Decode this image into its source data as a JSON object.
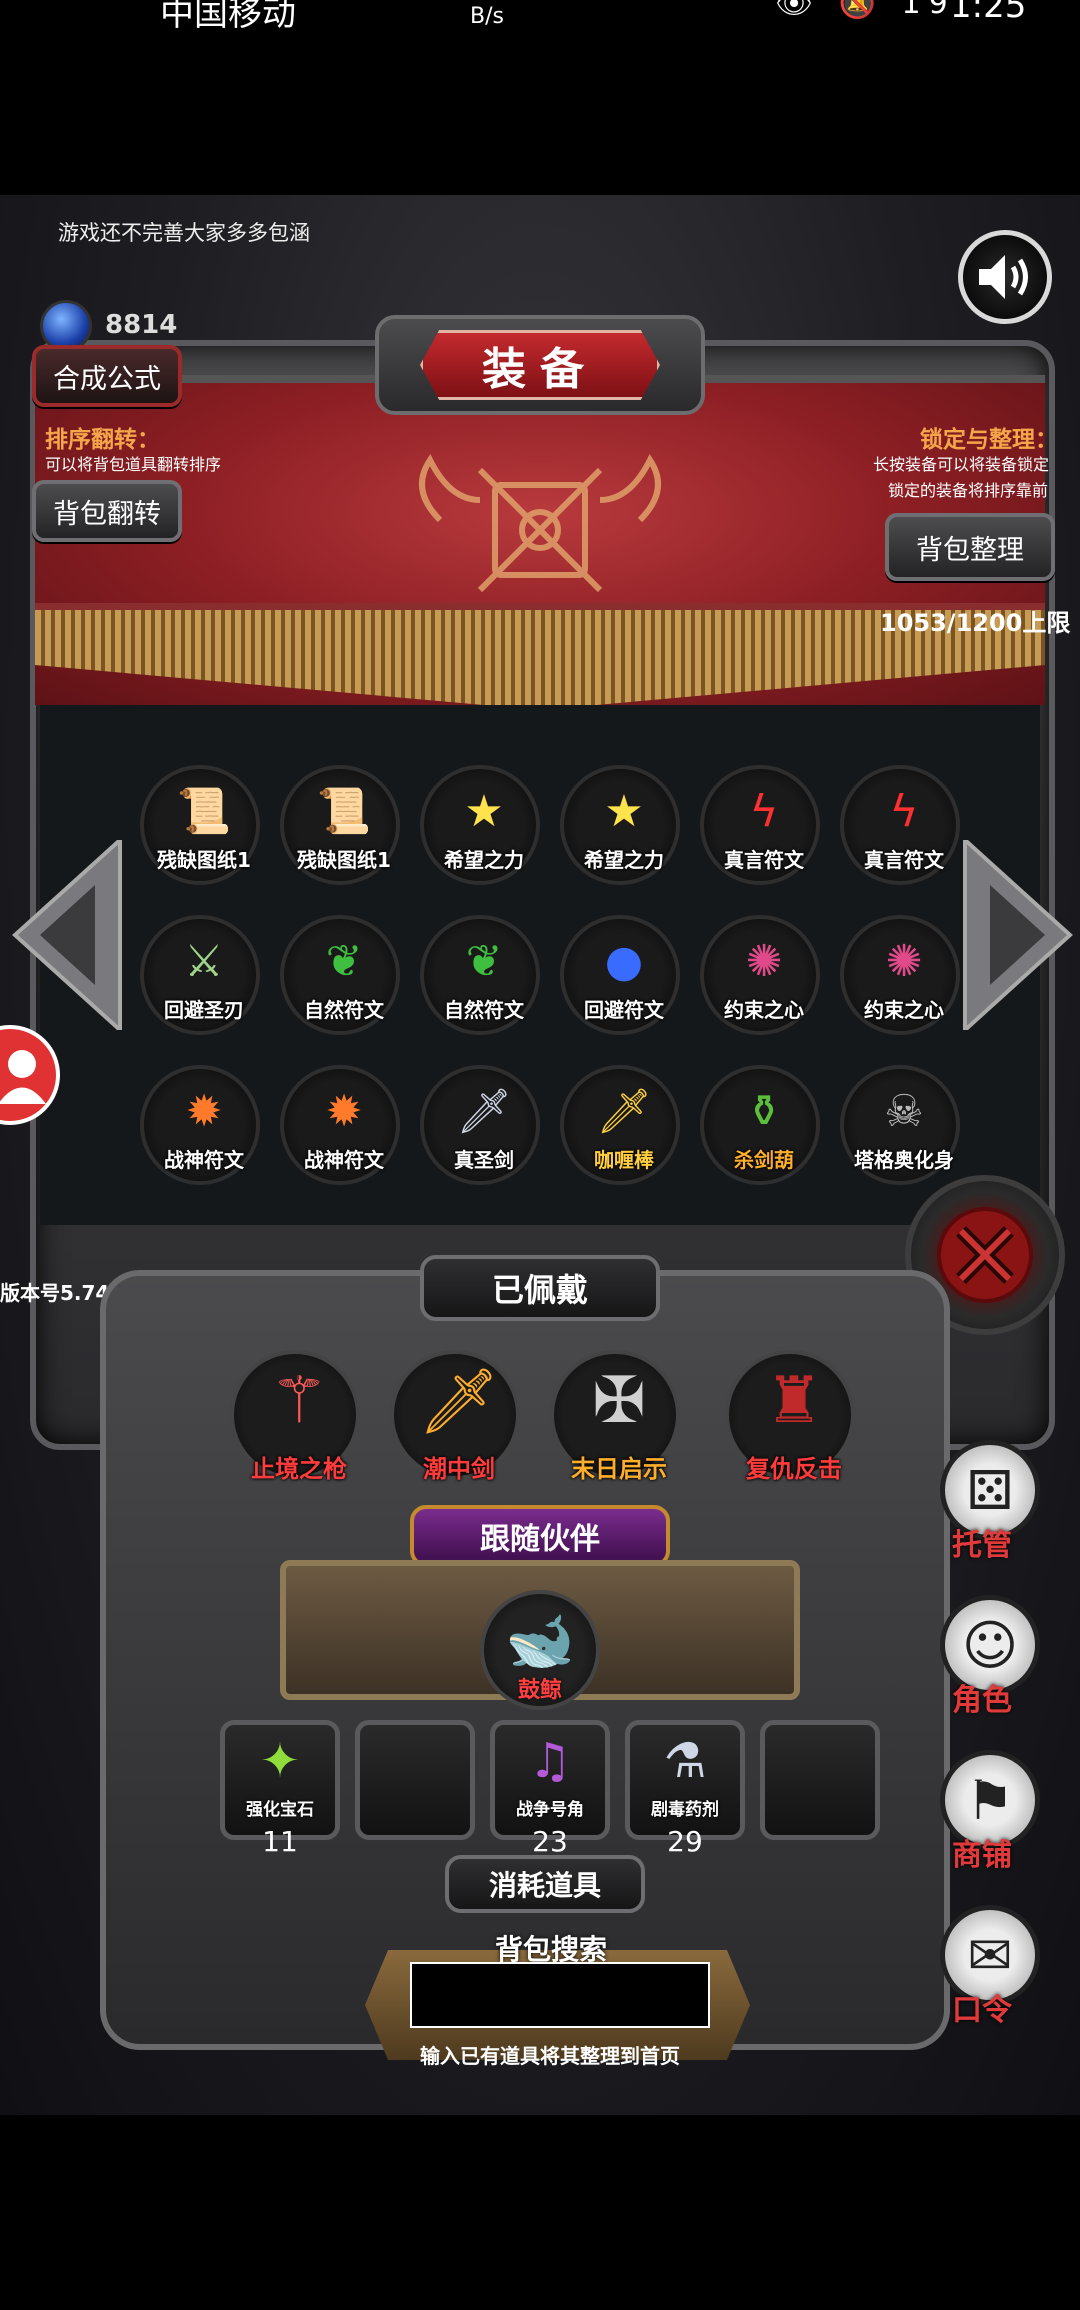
{
  "status": {
    "carrier": "中国移动",
    "hd": "HD",
    "net_speed": "B/s",
    "battery": "19",
    "time": "1:25"
  },
  "notice": "游戏还不完善大家多多包涵",
  "gems": "8814",
  "title": "装备",
  "buttons": {
    "synthesis": "合成公式",
    "bag_flip": "背包翻转",
    "bag_sort": "背包整理"
  },
  "sort_flip": {
    "label": "排序翻转：",
    "desc": "可以将背包道具翻转排序"
  },
  "lock_sort": {
    "label": "锁定与整理：",
    "desc1": "长按装备可以将装备锁定",
    "desc2": "锁定的装备将排序靠前"
  },
  "capacity": "1053/1200上限",
  "inventory": [
    {
      "name": "残缺图纸1",
      "icon": "scroll-icon",
      "glyph": "📜"
    },
    {
      "name": "残缺图纸1",
      "icon": "scroll-icon",
      "glyph": "📜"
    },
    {
      "name": "希望之力",
      "icon": "star-icon",
      "glyph": "★"
    },
    {
      "name": "希望之力",
      "icon": "star-icon",
      "glyph": "★"
    },
    {
      "name": "真言符文",
      "icon": "rune-icon",
      "glyph": "ϟ"
    },
    {
      "name": "真言符文",
      "icon": "rune-icon",
      "glyph": "ϟ"
    },
    {
      "name": "回避圣刃",
      "icon": "blade-icon",
      "glyph": "⚔"
    },
    {
      "name": "自然符文",
      "icon": "leaf-icon",
      "glyph": "❦"
    },
    {
      "name": "自然符文",
      "icon": "leaf-icon",
      "glyph": "❦"
    },
    {
      "name": "回避符文",
      "icon": "orb-icon",
      "glyph": "●"
    },
    {
      "name": "约束之心",
      "icon": "heart-icon",
      "glyph": "✺"
    },
    {
      "name": "约束之心",
      "icon": "heart-icon",
      "glyph": "✺"
    },
    {
      "name": "战神符文",
      "icon": "fire-rune-icon",
      "glyph": "✹"
    },
    {
      "name": "战神符文",
      "icon": "fire-rune-icon",
      "glyph": "✹"
    },
    {
      "name": "真圣剑",
      "icon": "sword-icon",
      "glyph": "🗡"
    },
    {
      "name": "咖喱棒",
      "icon": "gold-sword-icon",
      "glyph": "🗡"
    },
    {
      "name": "杀剑葫",
      "icon": "gourd-icon",
      "glyph": "⚱"
    },
    {
      "name": "塔格奥化身",
      "icon": "monster-icon",
      "glyph": "☠"
    }
  ],
  "version": "版本号5.74",
  "equipped_title": "已佩戴",
  "equipped": [
    {
      "name": "止境之枪",
      "color": "#ff3b3b",
      "icon": "spear-icon",
      "glyph": "⚚"
    },
    {
      "name": "潮中剑",
      "color": "#ff3b3b",
      "icon": "great-sword-icon",
      "glyph": "🗡"
    },
    {
      "name": "末日启示",
      "color": "#ffae2b",
      "icon": "cross-icon",
      "glyph": "✠"
    },
    {
      "name": "复仇反击",
      "color": "#ff3b3b",
      "icon": "armor-icon",
      "glyph": "♜"
    }
  ],
  "companion_title": "跟随伙伴",
  "companion": {
    "name": "鼓鲸",
    "icon": "whale-icon",
    "glyph": "🐋"
  },
  "consumables_title": "消耗道具",
  "consumables": [
    {
      "name": "强化宝石",
      "count": "11",
      "icon": "gem-icon",
      "glyph": "✦"
    },
    {
      "name": "",
      "count": "",
      "icon": "",
      "glyph": ""
    },
    {
      "name": "战争号角",
      "count": "23",
      "icon": "horn-icon",
      "glyph": "♫"
    },
    {
      "name": "剧毒药剂",
      "count": "29",
      "icon": "potion-icon",
      "glyph": "⚗"
    },
    {
      "name": "",
      "count": "",
      "icon": "",
      "glyph": ""
    }
  ],
  "search": {
    "title": "背包搜索",
    "hint": "输入已有道具将其整理到首页",
    "value": ""
  },
  "side": [
    {
      "label": "托管",
      "icon": "dice-icon",
      "glyph": "⚄"
    },
    {
      "label": "角色",
      "icon": "character-icon",
      "glyph": "☺"
    },
    {
      "label": "商铺",
      "icon": "shop-icon",
      "glyph": "⚑"
    },
    {
      "label": "口令",
      "icon": "book-icon",
      "glyph": "✉"
    }
  ]
}
